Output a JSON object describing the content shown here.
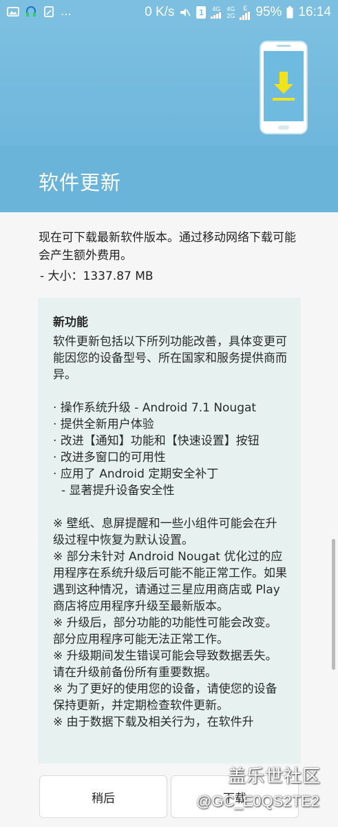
{
  "status_bar": {
    "network_speed": "0 K/s",
    "network_4g_a": "4G",
    "network_4g_b": "4G",
    "network_2g": "2G",
    "network_e": "E",
    "battery": "95%",
    "time": "16:14",
    "overflow": "...",
    "sim_label": "1"
  },
  "header": {
    "title": "软件更新",
    "accent_color": "#7cbfe0",
    "download_arrow_color": "#f2e21b"
  },
  "content": {
    "description": "现在可下载最新软件版本。通过移动网络下载可能会产生额外费用。",
    "size": "- 大小：1337.87 MB"
  },
  "notes": {
    "title": "新功能",
    "intro": "软件更新包括以下所列功能改善，具体变更可能因您的设备型号、所在国家和服务提供商而异。",
    "items": [
      "· 操作系统升级 - Android 7.1 Nougat",
      "· 提供全新用户体验",
      "· 改进【通知】功能和【快速设置】按钮",
      "· 改进多窗口的可用性",
      "· 应用了 Android 定期安全补丁",
      "- 显著提升设备安全性"
    ],
    "warnings": [
      "※ 壁纸、息屏提醒和一些小组件可能会在升级过程中恢复为默认设置。",
      "※ 部分未针对 Android Nougat 优化过的应用程序在系统升级后可能不能正常工作。如果遇到这种情况，请通过三星应用商店或 Play 商店将应用程序升级至最新版本。",
      "※ 升级后，部分功能的功能性可能会改变。部分应用程序可能无法正常工作。",
      "※ 升级期间发生错误可能会导致数据丢失。请在升级前备份所有重要数据。",
      "※ 为了更好的使用您的设备，请使您的设备保持更新，并定期检查软件更新。",
      "※ 由于数据下载及相关行为，在软件升"
    ]
  },
  "buttons": {
    "later": "稍后",
    "download": "下载"
  },
  "watermark": {
    "logo_text": "盖乐世社区",
    "user": "@GC_E0QS2TE2"
  }
}
